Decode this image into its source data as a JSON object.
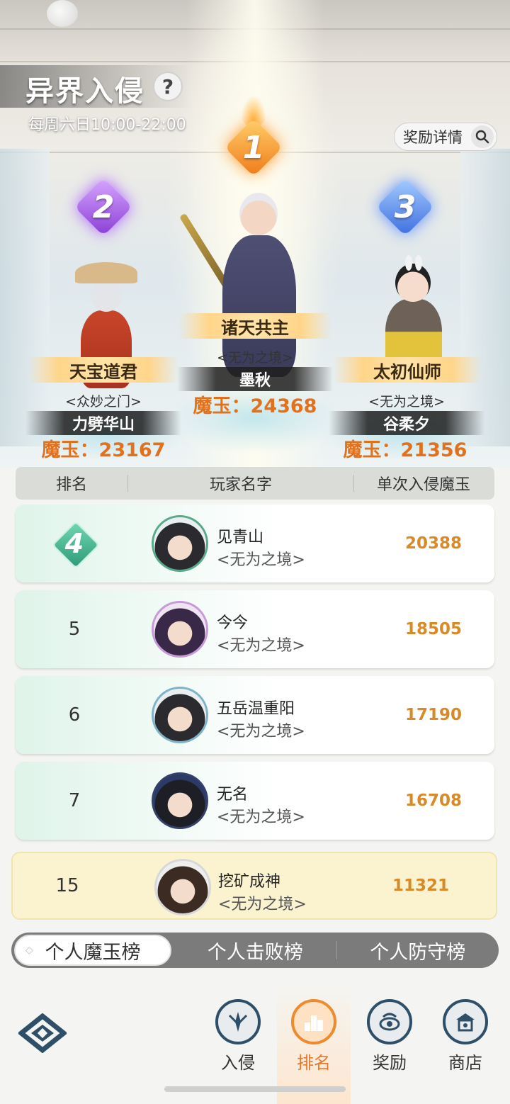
{
  "header": {
    "title": "异界入侵",
    "help_icon": "?",
    "schedule": "每周六日10:00-22:00",
    "reward_button": "奖励详情"
  },
  "podium": [
    {
      "rank": "1",
      "title": "诸天共主",
      "guild": "<无为之境>",
      "name": "墨秋",
      "score": "魔玉：24368"
    },
    {
      "rank": "2",
      "title": "天宝道君",
      "guild": "<众妙之门>",
      "name": "力劈华山",
      "score": "魔玉：23167"
    },
    {
      "rank": "3",
      "title": "太初仙师",
      "guild": "<无为之境>",
      "name": "谷柔夕",
      "score": "魔玉：21356"
    }
  ],
  "table": {
    "headers": [
      "排名",
      "玩家名字",
      "单次入侵魔玉"
    ],
    "rows": [
      {
        "rank": "4",
        "name": "见青山",
        "guild": "<无为之境>",
        "score": "20388"
      },
      {
        "rank": "5",
        "name": "今今",
        "guild": "<无为之境>",
        "score": "18505"
      },
      {
        "rank": "6",
        "name": "五岳温重阳",
        "guild": "<无为之境>",
        "score": "17190"
      },
      {
        "rank": "7",
        "name": "无名",
        "guild": "<无为之境>",
        "score": "16708"
      }
    ],
    "self": {
      "rank": "15",
      "name": "挖矿成神",
      "guild": "<无为之境>",
      "score": "11321"
    }
  },
  "tabs": [
    "个人魔玉榜",
    "个人击败榜",
    "个人防守榜"
  ],
  "nav": [
    {
      "label": "入侵",
      "icon": "invade-icon"
    },
    {
      "label": "排名",
      "icon": "ranking-icon"
    },
    {
      "label": "奖励",
      "icon": "reward-icon"
    },
    {
      "label": "商店",
      "icon": "shop-icon"
    }
  ],
  "colors": {
    "accent": "#e8772a",
    "score": "#d98a28",
    "nav_icon": "#2f4f68"
  }
}
